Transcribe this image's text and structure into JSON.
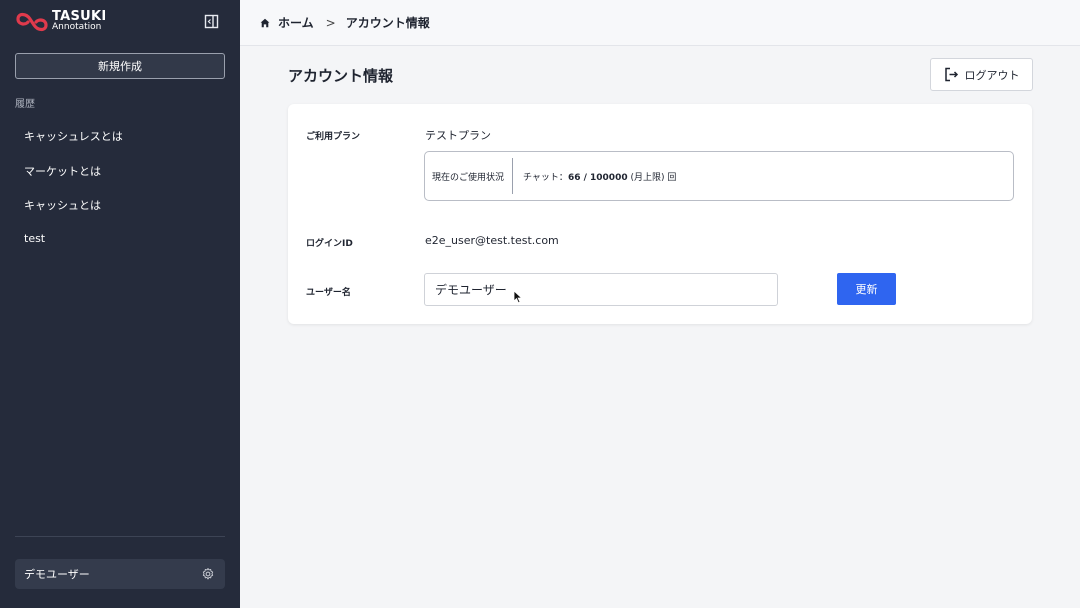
{
  "brand": {
    "title": "TASUKI",
    "subtitle": "Annotation",
    "accent": "#e03a4c"
  },
  "sidebar": {
    "new_button": "新規作成",
    "history_label": "履歴",
    "history": [
      "キャッシュレスとは",
      "マーケットとは",
      "キャッシュとは",
      "test"
    ],
    "user_name": "デモユーザー"
  },
  "breadcrumb": {
    "home": "ホーム",
    "separator": ">",
    "current": "アカウント情報"
  },
  "page": {
    "title": "アカウント情報",
    "logout_label": "ログアウト"
  },
  "account": {
    "plan_label": "ご利用プラン",
    "plan_value": "テストプラン",
    "usage_label": "現在のご使用状況",
    "usage_prefix": "チャット：",
    "usage_count": "66 / 100000",
    "usage_suffix": " (月上限) 回",
    "login_label": "ログインID",
    "login_value": "e2e_user@test.test.com",
    "username_label": "ユーザー名",
    "username_value": "デモユーザー",
    "update_label": "更新"
  },
  "colors": {
    "sidebar_bg": "#252b3b",
    "primary": "#2f65f0"
  }
}
